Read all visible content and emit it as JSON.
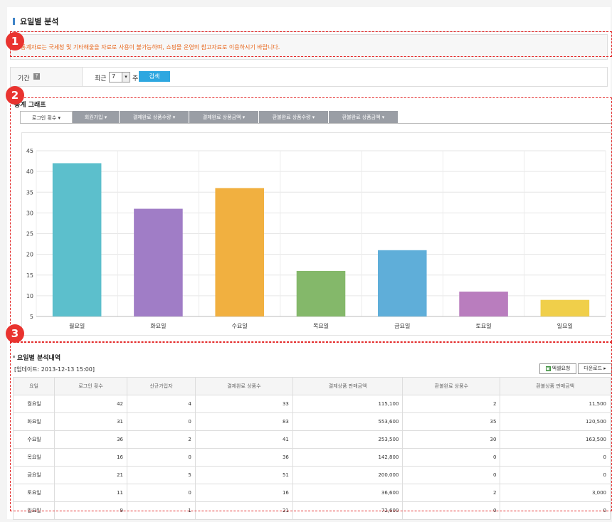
{
  "page": {
    "title": "요일별 분석"
  },
  "notice": {
    "text": "통계자료는 국세청 및 기타해울을 자료로 사용이 불가능하며, 쇼핑몰 운영의 참고자료로 이용하시기 바랍니다."
  },
  "badges": [
    "1",
    "2",
    "3"
  ],
  "filter": {
    "label": "기간",
    "help_icon": "?",
    "recent_label": "최근",
    "selected_value": "7",
    "unit": "주",
    "search_button": "검색"
  },
  "graph": {
    "section_title": "통계 그래프",
    "tabs": [
      "로그인 횟수 ▾",
      "회원가입 ▾",
      "결제완료 상품수량 ▾",
      "결제완료 상품금액 ▾",
      "환불완료 상품수량 ▾",
      "환불완료 상품금액 ▾"
    ],
    "active_tab": 0
  },
  "chart_data": {
    "type": "bar",
    "categories": [
      "월요일",
      "화요일",
      "수요일",
      "목요일",
      "금요일",
      "토요일",
      "일요일"
    ],
    "values": [
      42,
      31,
      36,
      16,
      21,
      11,
      9
    ],
    "colors": [
      "#5cbfcc",
      "#a07dc6",
      "#f1b040",
      "#84b86a",
      "#5faed9",
      "#b97dbe",
      "#f0cf4a"
    ],
    "y_ticks": [
      5,
      10,
      15,
      20,
      25,
      30,
      35,
      40,
      45
    ],
    "ylim": [
      5,
      45
    ],
    "grid": true
  },
  "details": {
    "title": "요일별 분석내역",
    "updated": "[업데이트: 2013-12-13 15:00]",
    "excel_button": "엑셀요청",
    "excel_icon": "▣",
    "download_button": "다운로드 ▸",
    "columns": [
      "요일",
      "로그인 횟수",
      "신규가입자",
      "결제완료 상품수",
      "결제상품 판매금액",
      "환불완료 상품수",
      "환불상품 판매금액"
    ],
    "rows": [
      [
        "월요일",
        "42",
        "4",
        "33",
        "115,100",
        "2",
        "11,500"
      ],
      [
        "화요일",
        "31",
        "0",
        "83",
        "553,600",
        "35",
        "120,500"
      ],
      [
        "수요일",
        "36",
        "2",
        "41",
        "253,500",
        "30",
        "163,500"
      ],
      [
        "목요일",
        "16",
        "0",
        "36",
        "142,800",
        "0",
        "0"
      ],
      [
        "금요일",
        "21",
        "5",
        "51",
        "200,000",
        "0",
        "0"
      ],
      [
        "토요일",
        "11",
        "0",
        "16",
        "36,600",
        "2",
        "3,000"
      ],
      [
        "일요일",
        "9",
        "1",
        "21",
        "72,600",
        "0",
        "0"
      ]
    ]
  }
}
